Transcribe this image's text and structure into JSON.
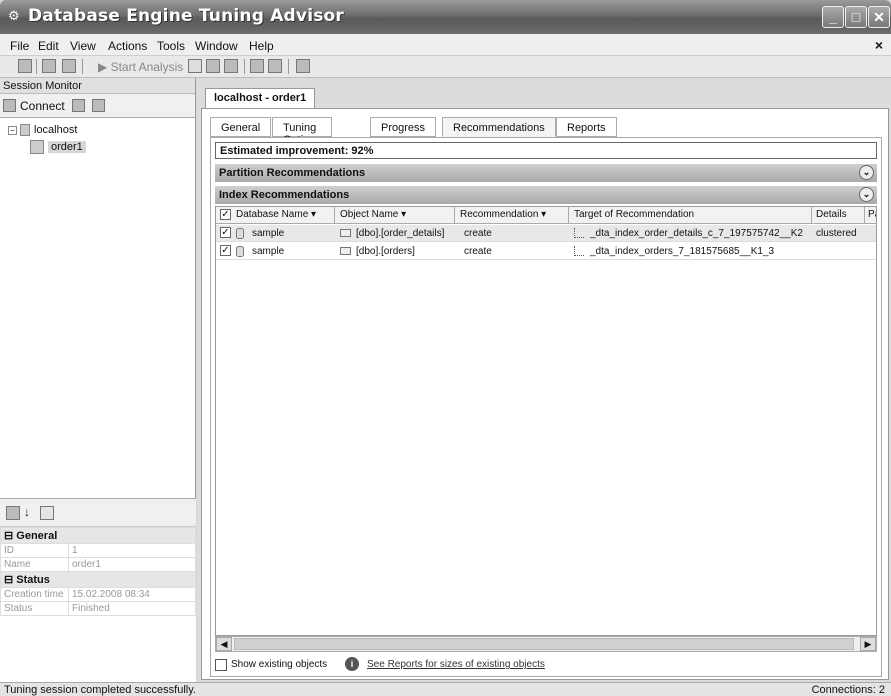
{
  "window": {
    "title": "Database Engine Tuning Advisor"
  },
  "menu": {
    "items": [
      "File",
      "Edit",
      "View",
      "Actions",
      "Tools",
      "Window",
      "Help"
    ]
  },
  "toolbar": {
    "start_analysis": "Start Analysis"
  },
  "session_monitor": {
    "header": "Session Monitor",
    "connect_label": "Connect",
    "tree": {
      "server": "localhost",
      "session": "order1"
    }
  },
  "properties": {
    "general_label": "General",
    "status_label": "Status",
    "rows": [
      {
        "name": "ID",
        "value": "1"
      },
      {
        "name": "Name",
        "value": "order1"
      },
      {
        "name": "Creation time",
        "value": "15.02.2008 08:34"
      },
      {
        "name": "Status",
        "value": "Finished"
      }
    ]
  },
  "document_tab": "localhost - order1",
  "subtabs": [
    "General",
    "Tuning Options",
    "Progress",
    "Recommendations",
    "Reports"
  ],
  "estimated_improvement": "Estimated improvement:  92%",
  "sections": {
    "partition": "Partition Recommendations",
    "index": "Index Recommendations"
  },
  "grid": {
    "headers": [
      "Database Name",
      "Object Name",
      "Recommendation",
      "Target of Recommendation",
      "Details",
      "Pa"
    ],
    "rows": [
      {
        "db": "sample",
        "object": "[dbo].[order_details]",
        "rec": "create",
        "target": "_dta_index_order_details_c_7_197575742__K2",
        "details": "clustered"
      },
      {
        "db": "sample",
        "object": "[dbo].[orders]",
        "rec": "create",
        "target": "_dta_index_orders_7_181575685__K1_3",
        "details": ""
      }
    ]
  },
  "footer": {
    "show_existing": "Show existing objects",
    "reports_link": "See Reports for sizes of existing objects"
  },
  "statusbar": {
    "left": "Tuning session completed successfully.",
    "right": "Connections: 2"
  }
}
